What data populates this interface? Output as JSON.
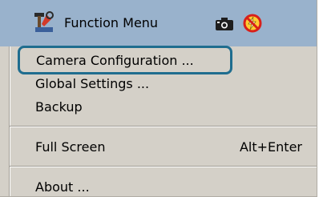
{
  "header": {
    "title": "Function Menu",
    "app_icon": "tools-icon",
    "camera_icon": "camera-icon",
    "flash_off_icon": "flash-off-icon"
  },
  "menu": {
    "items": [
      {
        "label": "Camera Configuration ...",
        "highlighted": true
      },
      {
        "label": "Global Settings ..."
      },
      {
        "label": "Backup"
      },
      {
        "label": "Full Screen",
        "shortcut": "Alt+Enter"
      },
      {
        "label": "About ..."
      }
    ]
  },
  "colors": {
    "header_bg": "#99b2cc",
    "menu_bg": "#d4d0c8",
    "highlight_border": "#1f6d8f"
  }
}
